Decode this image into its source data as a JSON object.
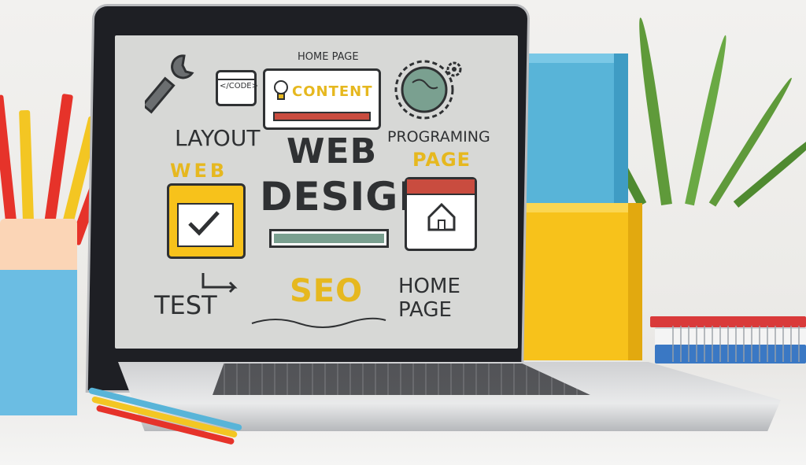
{
  "scene": {
    "description_labels": [],
    "screen_text": {
      "home_page_top": "HOME PAGE",
      "code": "</CODE>",
      "content": "CONTENT",
      "layout": "LAYOUT",
      "web_title": "WEB",
      "design": "DESIGN",
      "programing": "PROGRAMING",
      "page": "PAGE",
      "web_label": "WEB",
      "test": "TEST",
      "seo": "SEO",
      "home_page_bottom": "HOME PAGE"
    }
  },
  "colors": {
    "accent_yellow": "#e6b81f",
    "accent_red": "#c94c3f",
    "accent_green": "#7aa090",
    "block_blue": "#58b4d8",
    "block_yellow": "#f7c21b"
  },
  "icons": [
    "wrench-icon",
    "gear-icon",
    "globe-icon",
    "lightbulb-icon",
    "checkmark-icon",
    "house-icon",
    "arrow-icon"
  ]
}
